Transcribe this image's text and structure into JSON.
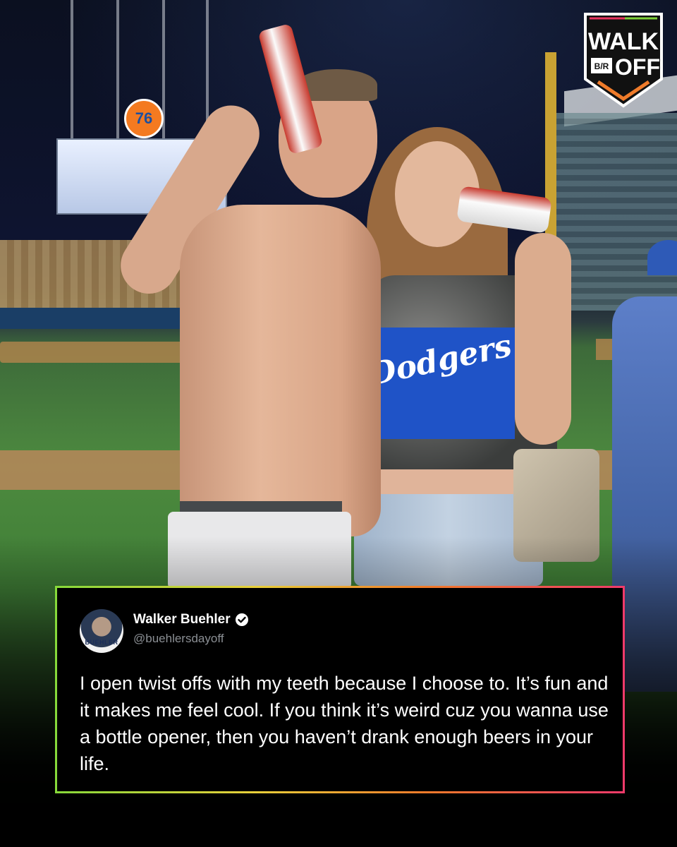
{
  "brand": {
    "logo_line1": "WALK",
    "logo_line2": "OFF",
    "logo_badge": "B/R",
    "colors": [
      "#7ed13a",
      "#f2c94c",
      "#ef7b2a",
      "#e8335f"
    ]
  },
  "photo": {
    "sign_76": "76",
    "shirt_text": "Dodgers"
  },
  "tweet": {
    "display_name": "Walker Buehler",
    "verified_icon": "verified-badge-icon",
    "handle": "@buehlersdayoff",
    "avatar_jersey": "BUEHLER",
    "text": "I open twist offs with my teeth because I choose to. It’s fun and it makes me feel cool. If you think it’s weird cuz you wanna use a bottle opener, then you haven’t drank enough beers in your life."
  }
}
